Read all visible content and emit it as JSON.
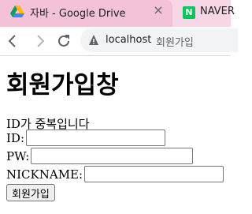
{
  "browser": {
    "active_tab": {
      "title": "자바 - Google Drive",
      "close": "×"
    },
    "inactive_tab": {
      "favicon_letter": "N",
      "title": "NAVER"
    },
    "address": {
      "host": "localhost",
      "page_title": "회원가입"
    },
    "colors": {
      "tab_strip": "#f7d6e6",
      "active_tab": "#f3c2d9",
      "naver_green": "#03c75a"
    }
  },
  "page": {
    "heading": "회원가입창",
    "message": "ID가 중복입니다",
    "fields": [
      {
        "label": "ID:",
        "value": ""
      },
      {
        "label": "PW:",
        "value": ""
      },
      {
        "label": "NICKNAME:",
        "value": ""
      }
    ],
    "submit_label": "회원가입"
  }
}
